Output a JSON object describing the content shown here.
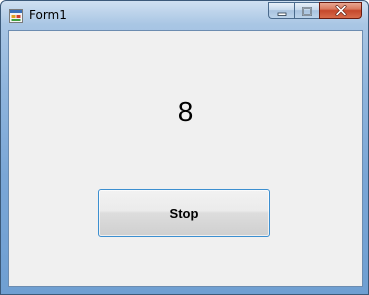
{
  "window": {
    "title": "Form1",
    "accent_color": "#6f9fd2",
    "close_color": "#c5472b"
  },
  "titlebar": {
    "icon": "form-app-icon",
    "controls": [
      "minimize-icon",
      "maximize-icon",
      "close-icon"
    ]
  },
  "main": {
    "counter_value": "8",
    "stop_label": "Stop"
  }
}
